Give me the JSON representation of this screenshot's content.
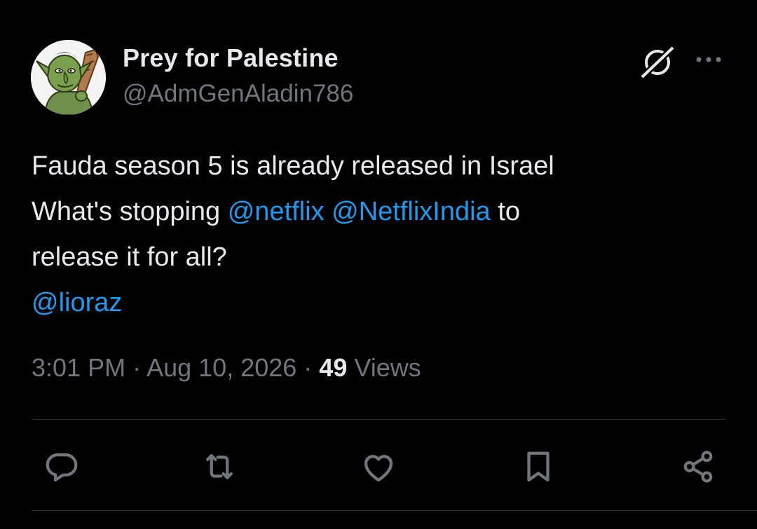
{
  "author": {
    "display_name": "Prey for Palestine",
    "handle": "@AdmGenAladin786",
    "avatar_icon": "goblin-with-club-avatar"
  },
  "header_icons": {
    "grok": "grok-icon",
    "more": "more-dots-icon"
  },
  "tweet": {
    "line1": "Fauda season 5 is already released in Israel",
    "line2_prefix": "What's stopping ",
    "mention1": "@netflix",
    "mention2": "@NetflixIndia",
    "line2_suffix": " to",
    "line3": "release it for all?",
    "mention3": "@lioraz"
  },
  "meta": {
    "time": "3:01 PM",
    "sep1": " · ",
    "date": "Aug 10, 2026",
    "sep2": " · ",
    "views_count": "49",
    "views_label": " Views"
  },
  "actions": [
    {
      "name": "reply",
      "icon": "reply-bubble-icon"
    },
    {
      "name": "retweet",
      "icon": "retweet-arrows-icon"
    },
    {
      "name": "like",
      "icon": "heart-icon"
    },
    {
      "name": "bookmark",
      "icon": "bookmark-icon"
    },
    {
      "name": "share",
      "icon": "share-nodes-icon"
    }
  ],
  "colors": {
    "background": "#000000",
    "text_primary": "#e7e9ea",
    "text_secondary": "#71767b",
    "link": "#1d9bf0",
    "divider": "#2f3336"
  }
}
